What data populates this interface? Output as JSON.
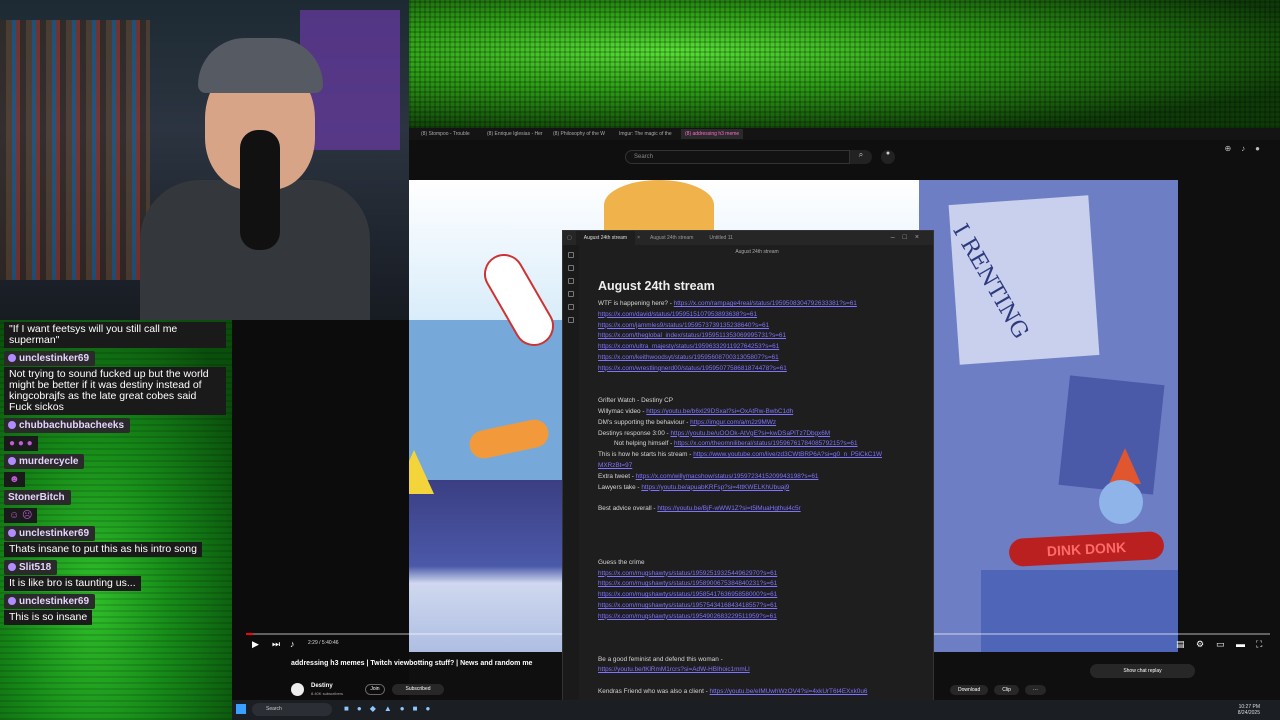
{
  "browser": {
    "tabs": [
      {
        "label": "(8) Stompoo - Trouble"
      },
      {
        "label": "(8) Enrique Iglesias - Her"
      },
      {
        "label": "(8) Philosophy of the W"
      },
      {
        "label": "Imgur: The magic of the"
      },
      {
        "label": "(8) addressing h3 meme",
        "active": true
      }
    ],
    "search_placeholder": "Search"
  },
  "video": {
    "sign_text": "I RENTING",
    "dink_text": "DINK DONK",
    "timestamp": "2:29 / 5:40:46",
    "progress_fraction": 0.007,
    "title": "addressing h3 memes | Twitch viewbotting stuff? | News and random me",
    "channel": "Destiny",
    "subs": "8.40K subscribers",
    "join_label": "Join",
    "subscribed_label": "Subscribed",
    "actions": {
      "download": "Download",
      "clip": "Clip",
      "more": "···"
    },
    "chat_replay_label": "Show chat replay"
  },
  "chat": {
    "messages": [
      {
        "user": "",
        "text": "\"If I want feetsys will you still call me superman\""
      },
      {
        "user": "unclestinker69",
        "text": "Not trying to sound fucked up but the world might be better if it was destiny instead of kingcobrajfs as the late great cobes said Fuck sickos"
      },
      {
        "user": "chubbachubbacheeks",
        "text": "",
        "emotes": "● ● ●"
      },
      {
        "user": "murdercycle",
        "text": "",
        "emotes": "☻"
      },
      {
        "user": "StonerBitch",
        "text": "",
        "emotes": "☺ ☹"
      },
      {
        "user": "unclestinker69",
        "text": "Thats insane to put this as his intro song"
      },
      {
        "user": "Slit518",
        "text": "It is like bro is taunting us..."
      },
      {
        "user": "unclestinker69",
        "text": "This is so insane"
      }
    ]
  },
  "notes": {
    "tabs": [
      {
        "label": "August 24th stream",
        "active": true
      },
      {
        "label": "August 24th stream"
      },
      {
        "label": "Untitled 11"
      }
    ],
    "header": "August 24th stream",
    "title": "August 24th stream",
    "block1": [
      {
        "prefix": "WTF is happening here? - ",
        "link": "https://x.com/rampage4real/status/1959508304792633381?s=61"
      },
      {
        "prefix": "",
        "link": "https://x.com/david/status/1959515107953893638?s=61"
      },
      {
        "prefix": "",
        "link": "https://x.com/jammles9/status/1959573739135238640?s=61"
      },
      {
        "prefix": "",
        "link": "https://x.com/theglobal_index/status/1959511353069995731?s=61"
      },
      {
        "prefix": "",
        "link": "https://x.com/ultra_majesty/status/1959633291192764253?s=61"
      },
      {
        "prefix": "",
        "link": "https://x.com/keithwoodsyt/status/1959560870031305807?s=61"
      },
      {
        "prefix": "",
        "link": "https://x.com/wrestlingnerd00/status/1959507758681874478?s=61"
      }
    ],
    "block2": [
      {
        "prefix": "Grifter Watch - Destiny CP",
        "link": "",
        "indent": false
      },
      {
        "prefix": "Willymac video - ",
        "link": "https://youtu.be/b6xl29DSxaI?si=OxAtRw-BwbC1dh",
        "indent": false
      },
      {
        "prefix": "DM's supporting the behaviour - ",
        "link": "https://imgur.com/a/m2z9MWz",
        "indent": false
      },
      {
        "prefix": "Destinys response 3:00 - ",
        "link": "https://youtu.be/uOOOk-AtVgE?si=kwDSaPlTz7Dbgx6M",
        "indent": false
      },
      {
        "prefix": "Not helping himself - ",
        "link": "https://x.com/theomniliberal/status/1959676178408579215?s=61",
        "indent": true
      },
      {
        "prefix": "This is how he starts his stream - ",
        "link": "https://www.youtube.com/live/zd3CWtBRP6A?si=g0_n_P5lCkC1W",
        "indent": false
      },
      {
        "prefix": "",
        "link": "MXRzBt=97",
        "indent": false
      },
      {
        "prefix": "Extra tweet - ",
        "link": "https://x.com/willymacshow/status/1959723415209943198?s=61",
        "indent": false
      },
      {
        "prefix": "Lawyers take - ",
        "link": "https://youtu.be/apuabKRFsp?si=4ttKWELKhUbuaj9",
        "indent": false
      }
    ],
    "advice": {
      "prefix": "Best advice overall - ",
      "link": "https://youtu.be/BjF-wWW1Z?si=t5lMuaHgthui4c5r"
    },
    "crime_label": "Guess the crime",
    "crime_links": [
      "https://x.com/mugshawtys/status/1959251932544962970?s=61",
      "https://x.com/mugshawtys/status/1958900675384840231?s=61",
      "https://x.com/mugshawtys/status/1958541763695858000?s=61",
      "https://x.com/mugshawtys/status/1957543416843418557?s=61",
      "https://x.com/mugshawtys/status/1954902683229511959?s=61"
    ],
    "feminist_label": "Be a good feminist and defend this woman - ",
    "feminist_link": "https://youtu.be/tKlRmM1rcrs?si=AdW-HBIhoic1mmLl",
    "kendra": {
      "prefix": "Kendras Friend who was also a client - ",
      "link": "https://youtu.be/eIMUwhWzOV4?si=4xkUrT6t4EXxk0u6"
    }
  },
  "taskbar": {
    "search_label": "Search",
    "clock_time": "10:27 PM",
    "clock_date": "8/24/2025"
  },
  "colors": {
    "accent_link": "#7f74ff",
    "progress": "#ff0000",
    "chat_bg": "#168a18"
  }
}
